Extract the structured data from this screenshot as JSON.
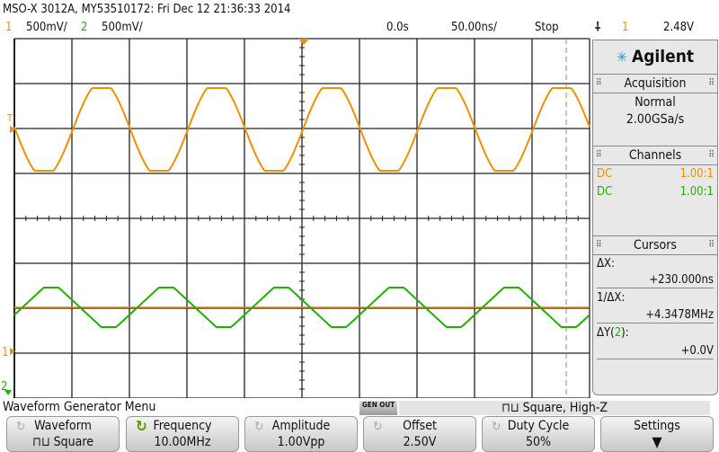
{
  "header": {
    "title": "MSO-X 3012A, MY53510172: Fri Dec 12 21:36:33 2014",
    "ch1_num": "1",
    "ch1_scale": "500mV/",
    "ch2_num": "2",
    "ch2_scale": "500mV/",
    "delay": "0.0s",
    "timebase": "50.00ns/",
    "run_state": "Stop",
    "trigger_icon": "rising-edge-icon",
    "trigger_source": "1",
    "trigger_level": "2.48V"
  },
  "colors": {
    "ch1": "#f09000",
    "ch2": "#22b000",
    "grid": "#222222"
  },
  "panel": {
    "brand": "Agilent",
    "acquisition": {
      "title": "Acquisition",
      "mode": "Normal",
      "rate": "2.00GSa/s"
    },
    "channels": {
      "title": "Channels",
      "rows": [
        {
          "coupling": "DC",
          "probe": "1.00:1"
        },
        {
          "coupling": "DC",
          "probe": "1.00:1"
        }
      ]
    },
    "cursors": {
      "title": "Cursors",
      "dx_label": "ΔX:",
      "dx": "+230.000ns",
      "inv_label": "1/ΔX:",
      "inv": "+4.3478MHz",
      "dy_label_a": "ΔY(",
      "dy_ch": "2",
      "dy_label_b": "):",
      "dy": "+0.0V"
    }
  },
  "markers": {
    "trig": "T",
    "ch1": "1",
    "ch2": "2"
  },
  "menu": {
    "title": "Waveform Generator Menu",
    "gen_out": "GEN OUT",
    "status": "Square, High-Z",
    "softkeys": [
      {
        "label": "Waveform",
        "value": "Square"
      },
      {
        "label": "Frequency",
        "value": "10.00MHz"
      },
      {
        "label": "Amplitude",
        "value": "1.00Vpp"
      },
      {
        "label": "Offset",
        "value": "2.50V"
      },
      {
        "label": "Duty Cycle",
        "value": "50%"
      },
      {
        "label": "Settings",
        "value": ""
      }
    ]
  }
}
